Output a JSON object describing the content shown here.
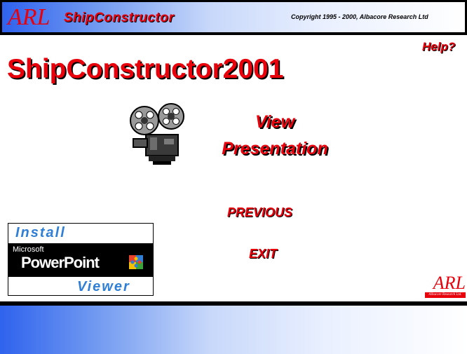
{
  "header": {
    "logo_text": "ARL",
    "product_name": "ShipConstructor",
    "copyright": "Copyright 1995 - 2000, Albacore Research Ltd"
  },
  "main": {
    "title": "ShipConstructor2001",
    "help_label": "Help?",
    "view_line1": "View",
    "view_line2": "Presentation",
    "previous_label": "PREVIOUS",
    "exit_label": "EXIT"
  },
  "powerpoint_viewer": {
    "install_label": "Install",
    "microsoft_label": "Microsoft",
    "powerpoint_label": "PowerPoint",
    "viewer_label": "Viewer"
  },
  "footer_logo": {
    "text": "ARL",
    "subtext": "Albacore Research Ltd."
  },
  "colors": {
    "accent_red": "#e8000b",
    "viewer_blue": "#2f7fd6",
    "gradient_blue": "#2f62ee"
  },
  "icons": [
    "film-projector-icon",
    "office-puzzle-logo-icon"
  ]
}
